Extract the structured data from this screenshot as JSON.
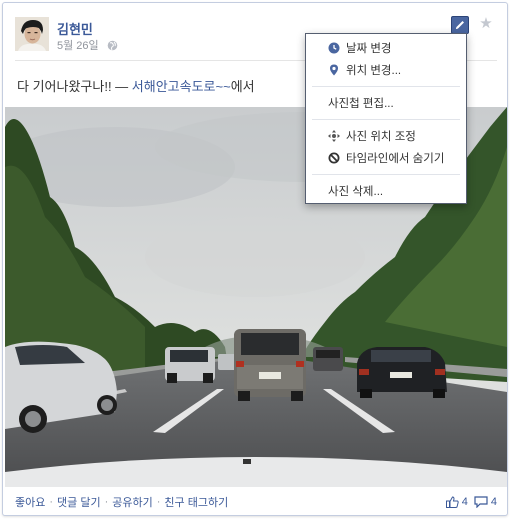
{
  "post": {
    "author": "김현민",
    "date": "5월 26일",
    "status_text": "다 기어나왔구나!! — ",
    "location_link": "서해안고속도로~~",
    "location_suffix": "에서"
  },
  "menu": {
    "items": [
      {
        "label": "날짜 변경",
        "icon": "clock-icon"
      },
      {
        "label": "위치 변경...",
        "icon": "location-pin-icon"
      }
    ],
    "edit_album": "사진첩 편집...",
    "items2": [
      {
        "label": "사진 위치 조정",
        "icon": "move-arrows-icon"
      },
      {
        "label": "타임라인에서 숨기기",
        "icon": "hide-circle-icon"
      }
    ],
    "delete_photo": "사진 삭제..."
  },
  "footer": {
    "actions": [
      "좋아요",
      "댓글 달기",
      "공유하기",
      "친구 태그하기"
    ],
    "like_count": "4",
    "comment_count": "4"
  },
  "colors": {
    "link": "#3b5998",
    "meta": "#90949c",
    "edit_button": "#4a66a0"
  }
}
